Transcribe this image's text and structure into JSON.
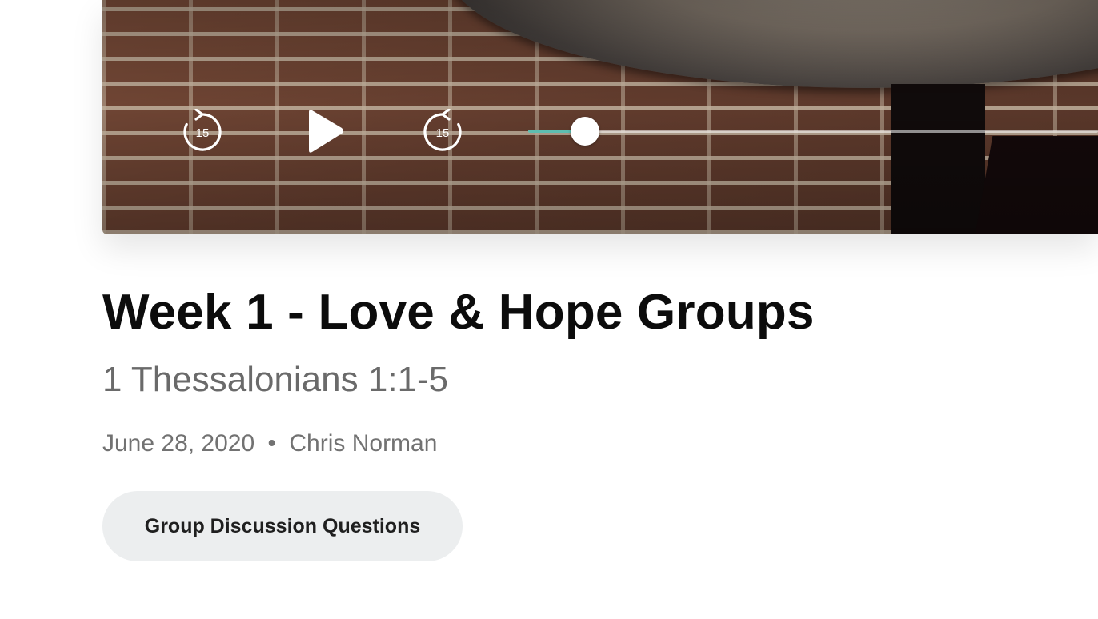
{
  "player": {
    "skip_back_icon": "rotate-ccw-15-icon",
    "skip_back_seconds": "15",
    "play_icon": "play-icon",
    "skip_forward_icon": "rotate-cw-15-icon",
    "skip_forward_seconds": "15",
    "progress_fraction": 0.1,
    "progress_color": "#5dbdb0",
    "thumbnail_description": "brick wall with table"
  },
  "sermon": {
    "title": "Week 1 - Love & Hope Groups",
    "scripture": "1 Thessalonians 1:1-5",
    "date": "June 28, 2020",
    "separator": "•",
    "speaker": "Chris Norman"
  },
  "actions": {
    "discussion_button_label": "Group Discussion Questions"
  }
}
